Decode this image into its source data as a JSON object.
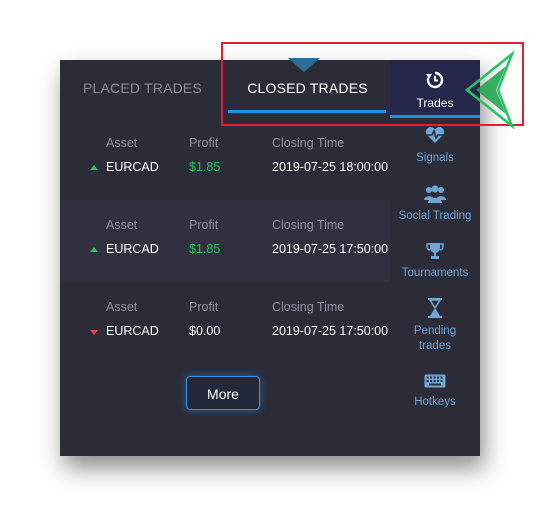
{
  "tabs": {
    "placed_label": "PLACED TRADES",
    "closed_label": "CLOSED TRADES"
  },
  "trades": [
    {
      "asset_header": "Asset",
      "profit_header": "Profit",
      "time_header": "Closing Time",
      "asset": "EURCAD",
      "profit": "$1.85",
      "closing_time": "2019-07-25 18:00:00",
      "direction": "up"
    },
    {
      "asset_header": "Asset",
      "profit_header": "Profit",
      "time_header": "Closing Time",
      "asset": "EURCAD",
      "profit": "$1.85",
      "closing_time": "2019-07-25 17:50:00",
      "direction": "up"
    },
    {
      "asset_header": "Asset",
      "profit_header": "Profit",
      "time_header": "Closing Time",
      "asset": "EURCAD",
      "profit": "$0.00",
      "closing_time": "2019-07-25 17:50:00",
      "direction": "down"
    }
  ],
  "more_label": "More",
  "sidebar": {
    "items": [
      {
        "label": "Trades",
        "icon": "history-icon"
      },
      {
        "label": "Signals",
        "icon": "heartbeat-icon"
      },
      {
        "label": "Social Trading",
        "icon": "users-icon"
      },
      {
        "label": "Tournaments",
        "icon": "trophy-icon"
      },
      {
        "label": "Pending",
        "label2": "trades",
        "icon": "hourglass-icon"
      },
      {
        "label": "Hotkeys",
        "icon": "keyboard-icon"
      }
    ]
  },
  "colors": {
    "panel_bg": "#2b2c38",
    "accent_blue": "#1f8fe0",
    "profit_green": "#22c55e",
    "loss_red": "#e8433a",
    "highlight_red": "#e2202d",
    "pointer_green": "#22c55e"
  }
}
